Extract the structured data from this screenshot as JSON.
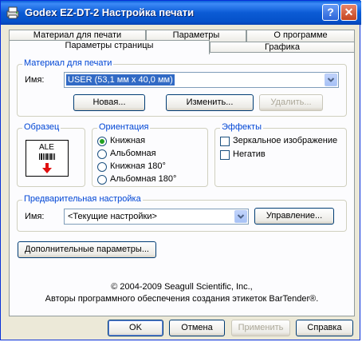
{
  "window": {
    "title": "Godex EZ-DT-2 Настройка печати",
    "help_glyph": "?",
    "close_glyph": "✕"
  },
  "tabs": {
    "row1": [
      "Материал для печати",
      "Параметры",
      "О программе"
    ],
    "row2": [
      "Параметры страницы",
      "Графика"
    ],
    "active": "Параметры страницы"
  },
  "media": {
    "group_title": "Материал для печати",
    "name_label": "Имя:",
    "name_value": "USER (53,1 мм х 40,0 мм)",
    "new_button": "Новая...",
    "edit_button": "Изменить...",
    "delete_button": "Удалить..."
  },
  "sample": {
    "group_title": "Образец",
    "label_text": "ALE"
  },
  "orientation": {
    "group_title": "Ориентация",
    "options": [
      "Книжная",
      "Альбомная",
      "Книжная 180°",
      "Альбомная 180°"
    ],
    "selected_index": 0
  },
  "effects": {
    "group_title": "Эффекты",
    "mirror": "Зеркальное изображение",
    "negative": "Негатив"
  },
  "preset": {
    "group_title": "Предварительная настройка",
    "name_label": "Имя:",
    "value": "<Текущие настройки>",
    "manage_button": "Управление..."
  },
  "advanced_button": "Дополнительные параметры...",
  "copyright": {
    "line1": "© 2004-2009 Seagull Scientific, Inc.,",
    "line2": "Авторы программного обеспечения создания этикеток BarTender®."
  },
  "footer": {
    "ok": "OK",
    "cancel": "Отмена",
    "apply": "Применить",
    "help": "Справка"
  },
  "colors": {
    "title_bar": "#0a5fd8",
    "group_title": "#0046d5",
    "selection": "#316ac5",
    "radio_dot": "#21a121",
    "arrow_red": "#e01010"
  }
}
